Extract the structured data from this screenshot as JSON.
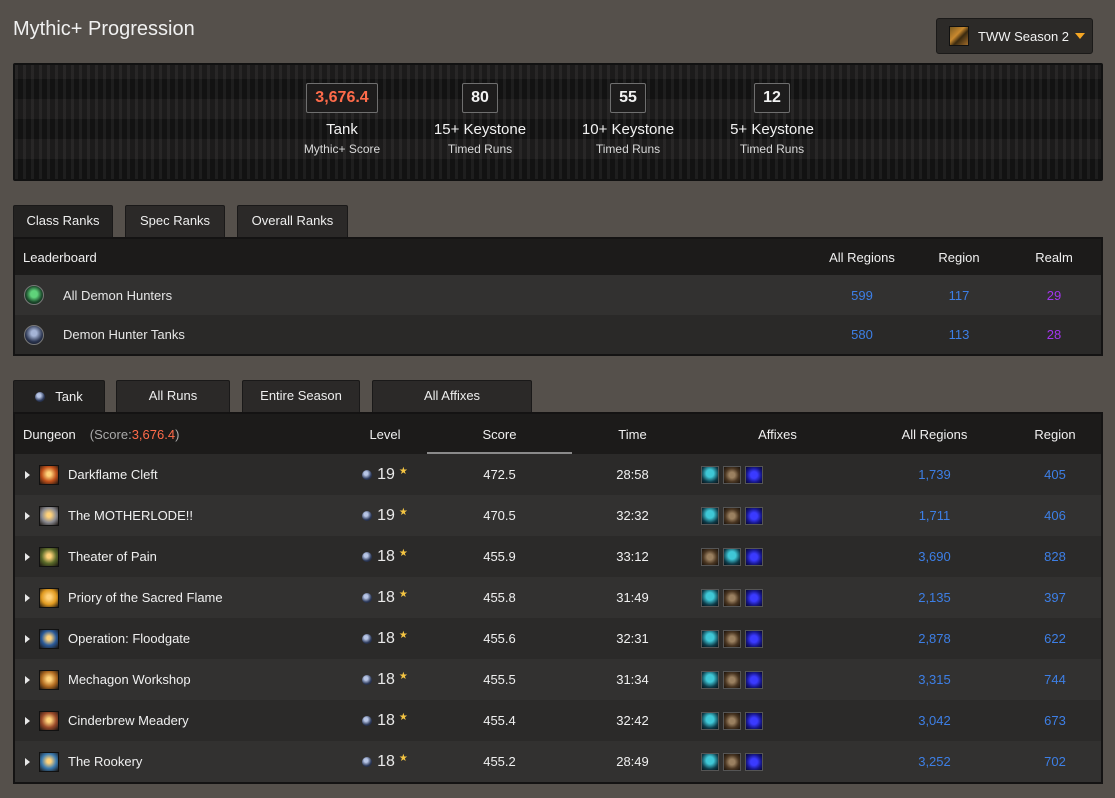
{
  "page": {
    "title": "Mythic+ Progression"
  },
  "season_selector": {
    "label": "TWW Season 2",
    "icon": "season-icon",
    "caret": "caret-down-icon"
  },
  "stats": [
    {
      "value": "3,676.4",
      "title": "Tank",
      "subtitle": "Mythic+ Score"
    },
    {
      "value": "80",
      "title": "15+ Keystone",
      "subtitle": "Timed Runs"
    },
    {
      "value": "55",
      "title": "10+ Keystone",
      "subtitle": "Timed Runs"
    },
    {
      "value": "12",
      "title": "5+ Keystone",
      "subtitle": "Timed Runs"
    }
  ],
  "rank_tabs": [
    "Class Ranks",
    "Spec Ranks",
    "Overall Ranks"
  ],
  "ranks_table": {
    "headers": {
      "label": "Leaderboard",
      "all_regions": "All Regions",
      "region": "Region",
      "realm": "Realm"
    },
    "rows": [
      {
        "name": "All Demon Hunters",
        "all_regions": "599",
        "region": "117",
        "realm": "29"
      },
      {
        "name": "Demon Hunter Tanks",
        "all_regions": "580",
        "region": "113",
        "realm": "28"
      }
    ]
  },
  "filter_tabs": [
    "Tank",
    "All Runs",
    "Entire Season",
    "All Affixes"
  ],
  "runs_table": {
    "headers": {
      "dungeon": "Dungeon",
      "score_prefix": "(Score: ",
      "score_value": "3,676.4",
      "score_suffix": ")",
      "level": "Level",
      "score": "Score",
      "time": "Time",
      "affixes": "Affixes",
      "all_regions": "All Regions",
      "region": "Region"
    },
    "rows": [
      {
        "dungeon": "Darkflame Cleft",
        "level": "19",
        "score": "472.5",
        "time": "28:58",
        "all_regions": "1,739",
        "region": "405",
        "icon_color": "#c0501a",
        "affixes": [
          "teal",
          "brown",
          "blue"
        ]
      },
      {
        "dungeon": "The MOTHERLODE!!",
        "level": "19",
        "score": "470.5",
        "time": "32:32",
        "all_regions": "1,711",
        "region": "406",
        "icon_color": "#8a8a90",
        "affixes": [
          "teal",
          "brown",
          "blue"
        ]
      },
      {
        "dungeon": "Theater of Pain",
        "level": "18",
        "score": "455.9",
        "time": "33:12",
        "all_regions": "3,690",
        "region": "828",
        "icon_color": "#5a6a2a",
        "affixes": [
          "brown",
          "teal",
          "blue"
        ]
      },
      {
        "dungeon": "Priory of the Sacred Flame",
        "level": "18",
        "score": "455.8",
        "time": "31:49",
        "all_regions": "2,135",
        "region": "397",
        "icon_color": "#e09a20",
        "affixes": [
          "teal",
          "brown",
          "blue"
        ]
      },
      {
        "dungeon": "Operation: Floodgate",
        "level": "18",
        "score": "455.6",
        "time": "32:31",
        "all_regions": "2,878",
        "region": "622",
        "icon_color": "#2a5a9a",
        "affixes": [
          "teal",
          "brown",
          "blue"
        ]
      },
      {
        "dungeon": "Mechagon Workshop",
        "level": "18",
        "score": "455.5",
        "time": "31:34",
        "all_regions": "3,315",
        "region": "744",
        "icon_color": "#b06a20",
        "affixes": [
          "teal",
          "brown",
          "blue"
        ]
      },
      {
        "dungeon": "Cinderbrew Meadery",
        "level": "18",
        "score": "455.4",
        "time": "32:42",
        "all_regions": "3,042",
        "region": "673",
        "icon_color": "#9a4a2a",
        "affixes": [
          "teal",
          "brown",
          "blue"
        ]
      },
      {
        "dungeon": "The Rookery",
        "level": "18",
        "score": "455.2",
        "time": "28:49",
        "all_regions": "3,252",
        "region": "702",
        "icon_color": "#3a7ab0",
        "affixes": [
          "teal",
          "brown",
          "blue"
        ]
      }
    ]
  },
  "colors": {
    "score": "#ff6b4a",
    "rank_blue": "#3d7fe6",
    "realm_purple": "#a335ee",
    "star": "#f5c542"
  }
}
